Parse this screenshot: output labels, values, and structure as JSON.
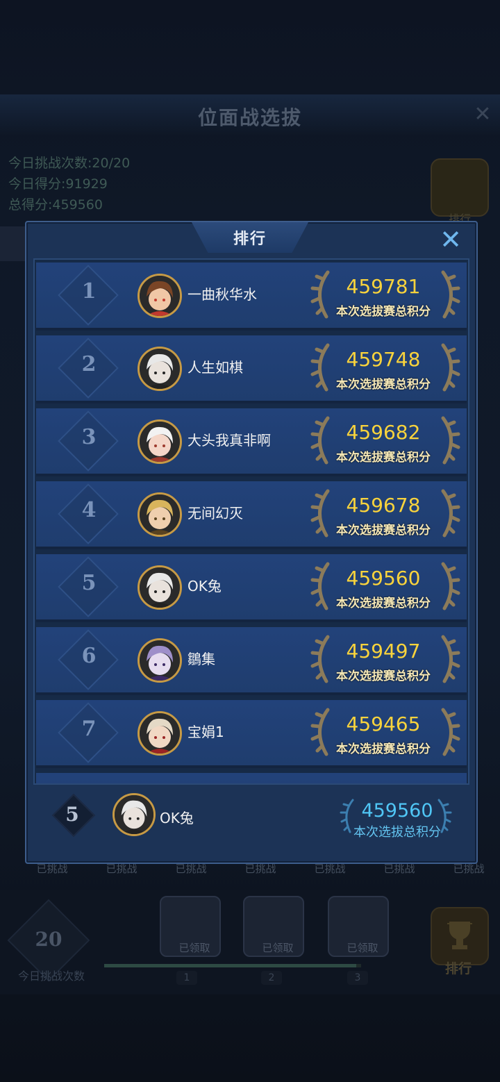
{
  "background": {
    "title": "位面战选拔",
    "stats": [
      "今日挑战次数:20/20",
      "今日得分:91929",
      "总得分:459560"
    ],
    "rank_label": "排行",
    "challenge_labels": [
      "已挑战",
      "已挑战",
      "已挑战",
      "已挑战",
      "已挑战",
      "已挑战",
      "已挑战"
    ],
    "today_count": "20",
    "today_count_label": "今日挑战次数",
    "chests": [
      {
        "label": "已领取",
        "milestone": "1"
      },
      {
        "label": "已领取",
        "milestone": "2"
      },
      {
        "label": "已领取",
        "milestone": "3"
      }
    ],
    "progress": 0.98,
    "trophy_label": "排行"
  },
  "modal": {
    "title": "排行",
    "score_label": "本次选拔赛总积分",
    "rows": [
      {
        "rank": "1",
        "name": "一曲秋华水",
        "score": "459781",
        "avatar": "brown-hair-hero"
      },
      {
        "rank": "2",
        "name": "人生如棋",
        "score": "459748",
        "avatar": "white-hair-hero"
      },
      {
        "rank": "3",
        "name": "大头我真非啊",
        "score": "459682",
        "avatar": "silver-elf-hero"
      },
      {
        "rank": "4",
        "name": "无间幻灭",
        "score": "459678",
        "avatar": "blonde-hero"
      },
      {
        "rank": "5",
        "name": "OK兔",
        "score": "459560",
        "avatar": "white-hair-hero"
      },
      {
        "rank": "6",
        "name": "鶵集",
        "score": "459497",
        "avatar": "purple-hair-hero"
      },
      {
        "rank": "7",
        "name": "宝娟1",
        "score": "459465",
        "avatar": "red-hat-hero"
      }
    ],
    "self": {
      "rank": "5",
      "name": "OK兔",
      "score": "459560",
      "label": "本次选拔总积分",
      "avatar": "white-hair-hero"
    }
  },
  "colors": {
    "gold": "#f9d33c",
    "blue_score": "#50c6f5",
    "panel": "#1c3356"
  }
}
